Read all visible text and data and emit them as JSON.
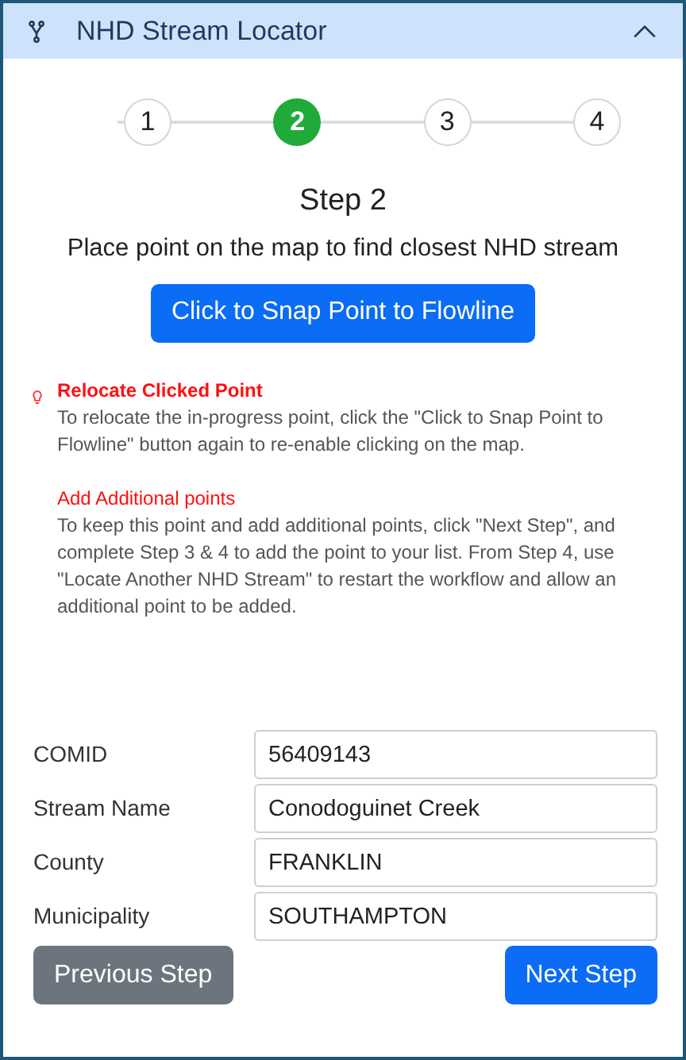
{
  "panel": {
    "title": "NHD Stream Locator",
    "expanded": true
  },
  "steps": [
    {
      "label": "1",
      "selected": false
    },
    {
      "label": "2",
      "selected": true
    },
    {
      "label": "3",
      "selected": false
    },
    {
      "label": "4",
      "selected": false
    }
  ],
  "heading": "Step 2",
  "instruction": "Place point on the map to find closest NHD stream",
  "snap_button": "Click to Snap Point to Flowline",
  "notes": [
    {
      "title": "Relocate Clicked Point",
      "kind": "tip",
      "text": "To relocate the in-progress point, click the \"Click to Snap Point to Flowline\" button again to re-enable clicking on the map."
    },
    {
      "title": "Add Additional points",
      "kind": "plain",
      "text": "To keep this point and add additional points, click \"Next Step\", and complete Step 3 & 4 to add the point to your list. From Step 4, use \"Locate Another NHD Stream\" to restart the workflow and allow an additional point to be added."
    }
  ],
  "fields": [
    {
      "label": "COMID",
      "value": "56409143"
    },
    {
      "label": "Stream Name",
      "value": "Conodoguinet Creek"
    },
    {
      "label": "County",
      "value": "FRANKLIN"
    },
    {
      "label": "Municipality",
      "value": "SOUTHAMPTON"
    }
  ],
  "buttons": {
    "previous": "Previous Step",
    "next": "Next Step"
  }
}
